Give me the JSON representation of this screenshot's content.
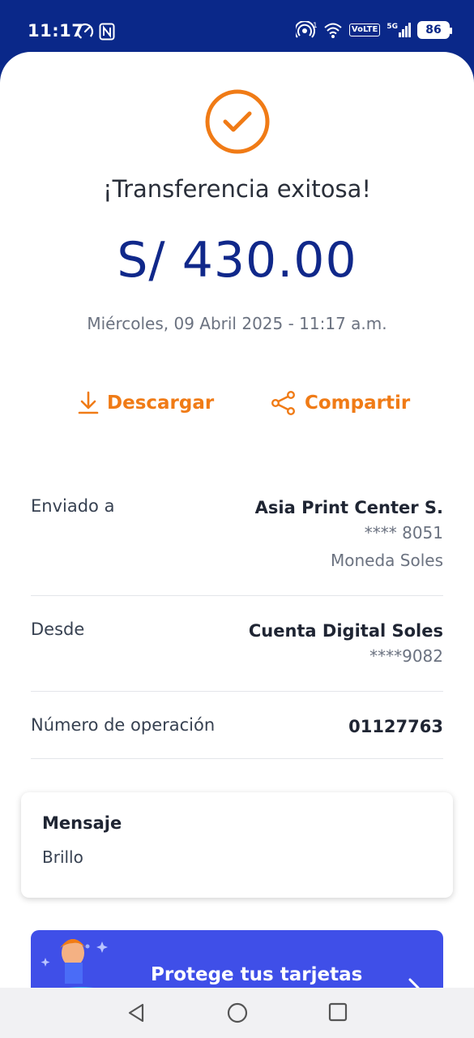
{
  "status_bar": {
    "time": "11:17",
    "network": "5G",
    "volte": "VoLTE",
    "battery": "86"
  },
  "receipt": {
    "title": "¡Transferencia exitosa!",
    "amount": "S/ 430.00",
    "date": "Miércoles, 09 Abril 2025 - 11:17 a.m.",
    "accent_color": "#f07b16",
    "brand_color": "#10288a"
  },
  "actions": {
    "download_label": "Descargar",
    "share_label": "Compartir"
  },
  "details": {
    "sent_to_label": "Enviado a",
    "sent_to_name": "Asia Print Center S.",
    "sent_to_account": "**** 8051",
    "sent_to_currency": "Moneda Soles",
    "from_label": "Desde",
    "from_account_name": "Cuenta Digital Soles",
    "from_account_number": "****9082",
    "operation_label": "Número de operación",
    "operation_number": "01127763"
  },
  "message": {
    "title": "Mensaje",
    "text": "Brillo"
  },
  "promo": {
    "text": "Protege tus tarjetas"
  }
}
